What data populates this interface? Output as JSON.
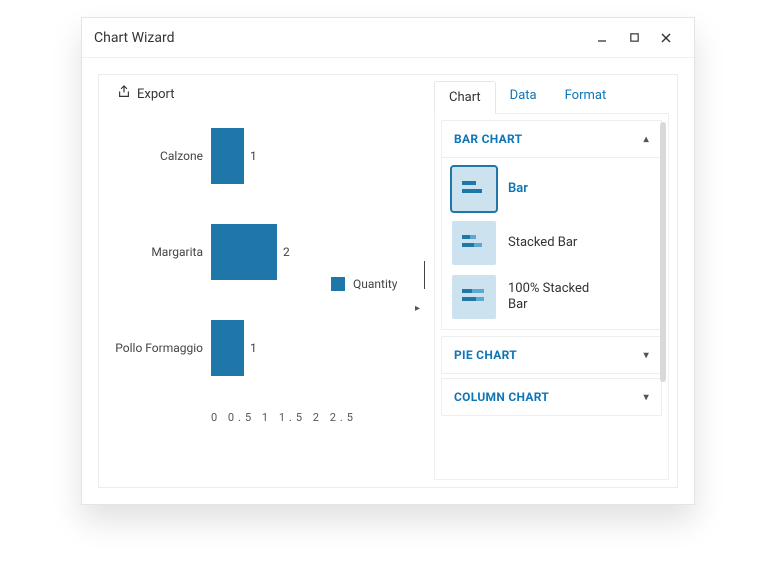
{
  "window": {
    "title": "Chart Wizard"
  },
  "export_label": "Export",
  "chart_data": {
    "type": "bar",
    "orientation": "horizontal",
    "categories": [
      "Calzone",
      "Margarita",
      "Pollo Formaggio"
    ],
    "values": [
      1,
      2,
      1
    ],
    "xlabel": "",
    "ylabel": "",
    "ticks": [
      0,
      0.5,
      1,
      1.5,
      2,
      2.5
    ],
    "xlim": [
      0,
      2.5
    ],
    "legend": "Quantity",
    "color": "#1f76a8"
  },
  "tick_string": "0   0.5   1   1.5   2   2.5",
  "panel": {
    "tabs": [
      "Chart",
      "Data",
      "Format"
    ],
    "active_tab": 0,
    "sections": {
      "bar": {
        "title": "BAR CHART",
        "expanded": true,
        "items": [
          {
            "label": "Bar",
            "selected": true
          },
          {
            "label": "Stacked Bar",
            "selected": false
          },
          {
            "label": "100% Stacked Bar",
            "selected": false
          }
        ]
      },
      "pie": {
        "title": "PIE CHART",
        "expanded": false
      },
      "column": {
        "title": "COLUMN CHART",
        "expanded": false
      }
    }
  }
}
